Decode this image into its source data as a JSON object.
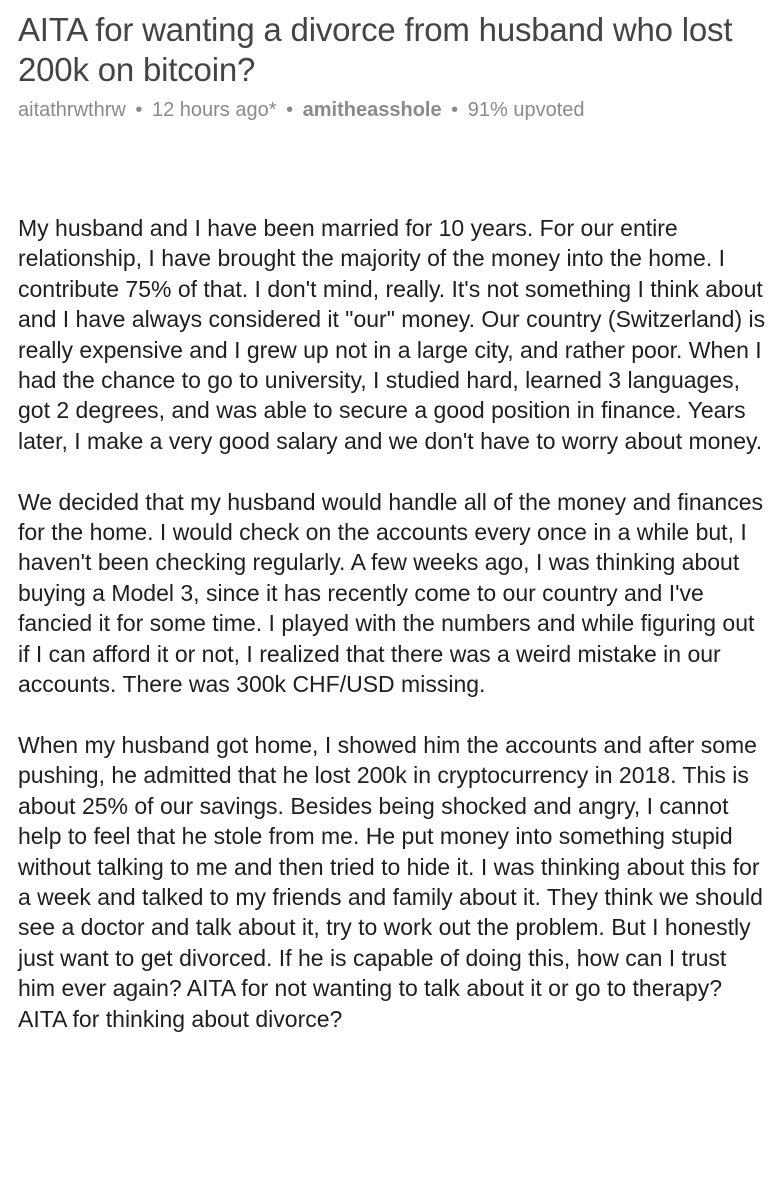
{
  "post": {
    "title": "AITA for wanting a divorce from husband who lost 200k on bitcoin?",
    "author": "aitathrwthrw",
    "time": "12 hours ago*",
    "subreddit": "amitheasshole",
    "upvoted": "91% upvoted",
    "separator": "•",
    "paragraphs": [
      "My husband and I have been married for 10 years. For our entire relationship, I have brought the majority of the money into the home. I contribute 75% of that. I don't mind, really. It's not something I think about and I have always considered it \"our\" money. Our country (Switzerland) is really expensive and I grew up not in a large city, and rather poor. When I had the chance to go to university, I studied hard, learned 3 languages, got 2 degrees, and was able to secure a good position in finance. Years later, I make a very good salary and we don't have to worry about money.",
      "We decided that my husband would handle all of the money and finances for the home. I would check on the accounts every once in a while but, I haven't been checking regularly. A few weeks ago, I was thinking about buying a Model 3, since it has recently come to our country and I've fancied it for some time. I played with the numbers and while figuring out if I can afford it or not, I realized that there was a weird mistake in our accounts. There was 300k CHF/USD missing.",
      "When my husband got home, I showed him the accounts and after some pushing, he admitted that he lost 200k in cryptocurrency in 2018. This is about 25% of our savings. Besides being shocked and angry, I cannot help to feel that he stole from me. He put money into something stupid without talking to me and then tried to hide it. I was thinking about this for a week and talked to my friends and family about it. They think we should see a doctor and talk about it, try to work out the problem. But I honestly just want to get divorced. If he is capable of doing this, how can I trust him ever again? AITA for not wanting to talk about it or go to therapy? AITA for thinking about divorce?"
    ]
  }
}
